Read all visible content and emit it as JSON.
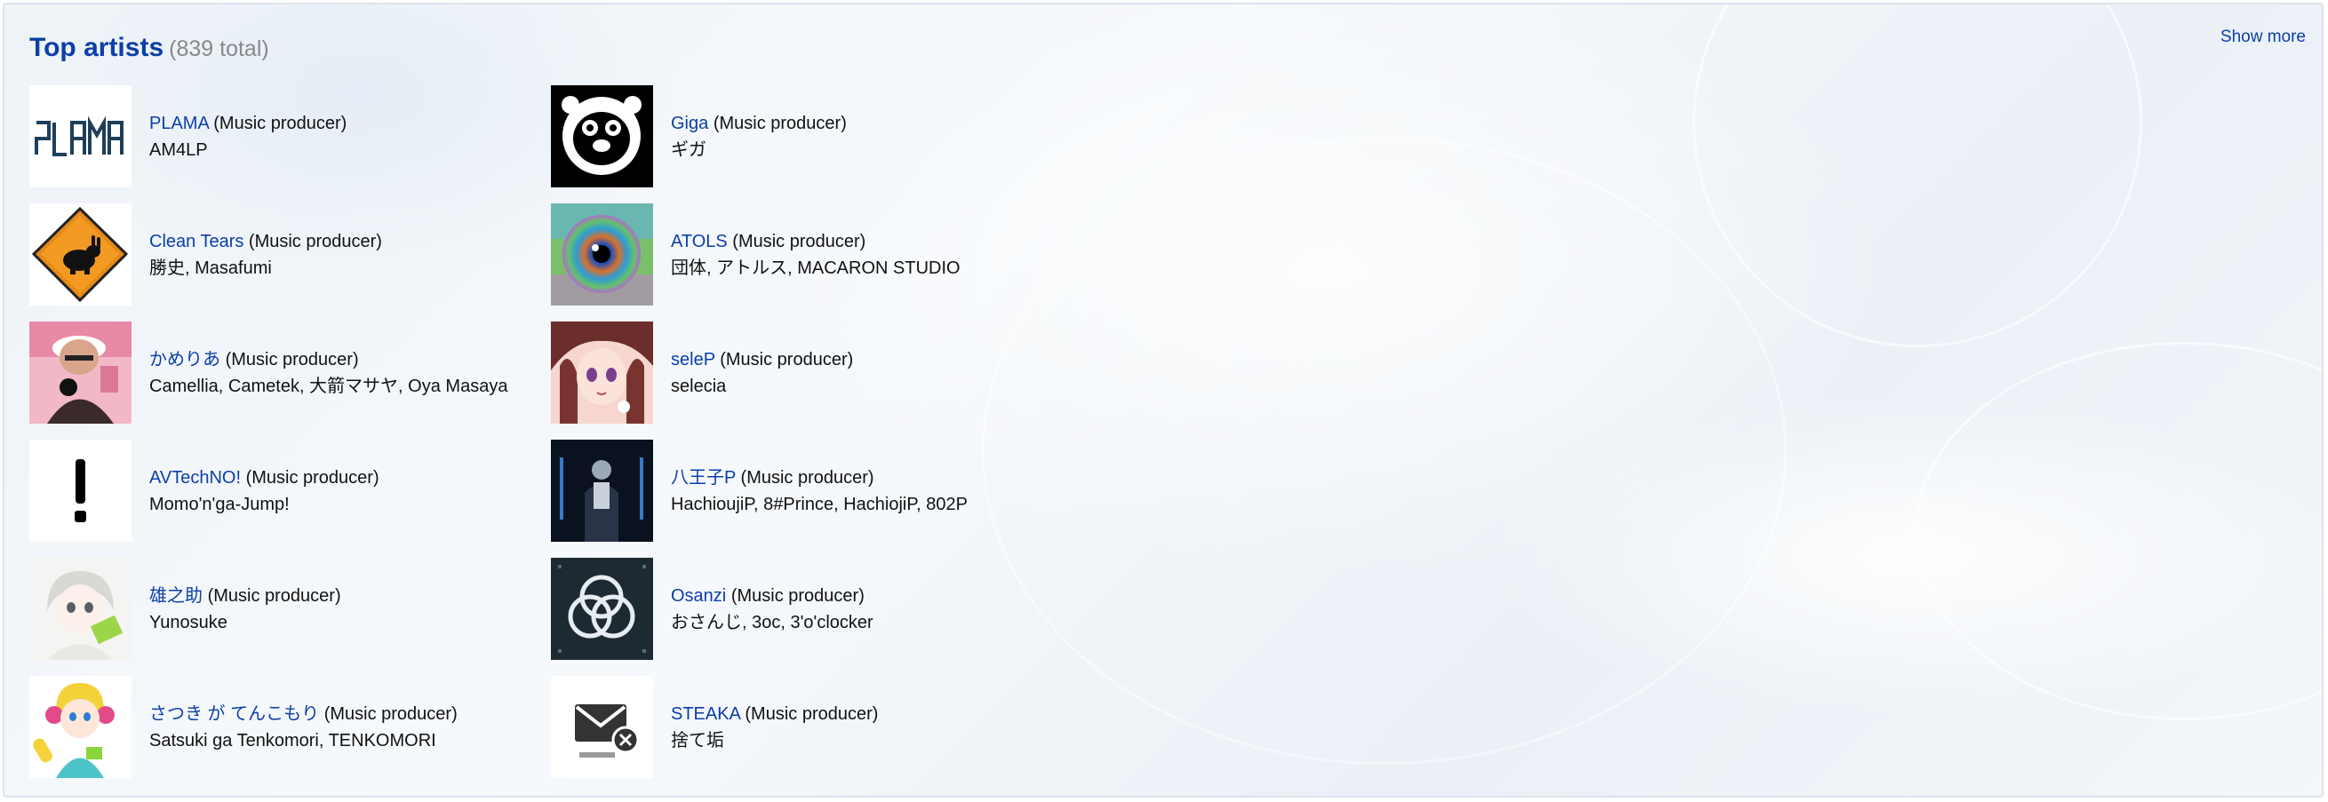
{
  "section": {
    "title": "Top artists",
    "total": "(839 total)",
    "show_more": "Show more"
  },
  "artists": [
    {
      "name": "PLAMA",
      "type": "(Music producer)",
      "aliases": "AM4LP",
      "icon": "plama-logo"
    },
    {
      "name": "Giga",
      "type": "(Music producer)",
      "aliases": "ギガ",
      "icon": "bear-avatar"
    },
    {
      "name": "Clean Tears",
      "type": "(Music producer)",
      "aliases": "勝史, Masafumi",
      "icon": "warning-sign-rabbit"
    },
    {
      "name": "ATOLS",
      "type": "(Music producer)",
      "aliases": "団体, アトルス, MACARON STUDIO",
      "icon": "eye-artwork"
    },
    {
      "name": "かめりあ",
      "type": "(Music producer)",
      "aliases": "Camellia, Cametek, 大箭マサヤ, Oya Masaya",
      "icon": "dj-photo"
    },
    {
      "name": "seleP",
      "type": "(Music producer)",
      "aliases": "selecia",
      "icon": "anime-girl"
    },
    {
      "name": "AVTechNO!",
      "type": "(Music producer)",
      "aliases": "Momo'n'ga-Jump!",
      "icon": "exclamation"
    },
    {
      "name": "八王子P",
      "type": "(Music producer)",
      "aliases": "HachioujiP, 8#Prince, HachiojiP, 802P",
      "icon": "stage-photo"
    },
    {
      "name": "雄之助",
      "type": "(Music producer)",
      "aliases": "Yunosuke",
      "icon": "anime-boy"
    },
    {
      "name": "Osanzi",
      "type": "(Music producer)",
      "aliases": "おさんじ, 3oc, 3'o'clocker",
      "icon": "triple-ring-logo"
    },
    {
      "name": "さつき が てんこもり",
      "type": "(Music producer)",
      "aliases": "Satsuki ga Tenkomori, TENKOMORI",
      "icon": "anime-headphones"
    },
    {
      "name": "STEAKA",
      "type": "(Music producer)",
      "aliases": "捨て垢",
      "icon": "mail-logo"
    }
  ],
  "colors": {
    "link": "#0b3ea8",
    "text": "#111111",
    "muted": "#888888"
  }
}
